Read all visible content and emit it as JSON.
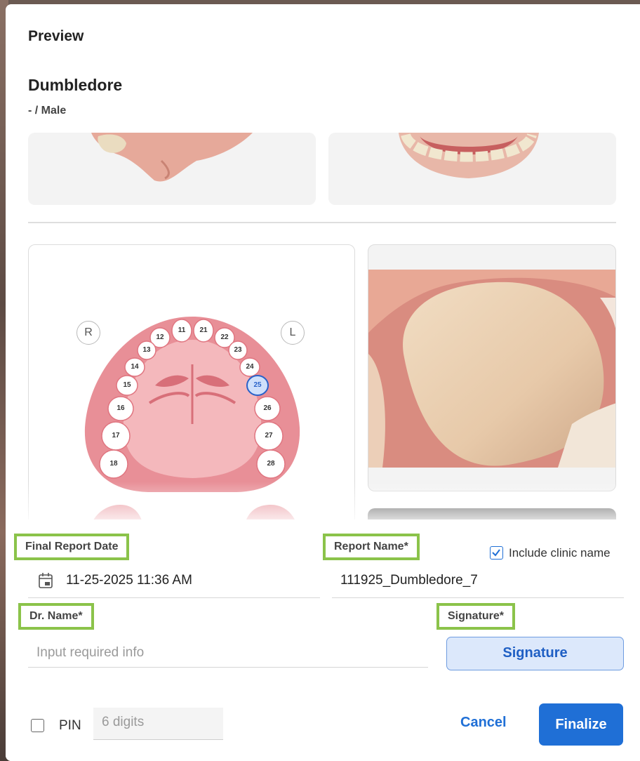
{
  "dialog": {
    "title": "Preview",
    "patient_name": "Dumbledore",
    "patient_meta": "- / Male"
  },
  "tooth_chart": {
    "right_label": "R",
    "left_label": "L",
    "teeth": [
      "11",
      "12",
      "13",
      "14",
      "15",
      "16",
      "17",
      "18",
      "21",
      "22",
      "23",
      "24",
      "25",
      "26",
      "27",
      "28"
    ],
    "selected_tooth": "25"
  },
  "form": {
    "final_report_date_label": "Final Report Date",
    "final_report_date_value": "11-25-2025 11:36 AM",
    "report_name_label": "Report Name*",
    "report_name_value": "111925_Dumbledore_7",
    "include_clinic_label": "Include clinic name",
    "include_clinic_checked": true,
    "dr_name_label": "Dr. Name*",
    "dr_name_placeholder": "Input required info",
    "signature_label": "Signature*",
    "signature_button": "Signature",
    "pin_label": "PIN",
    "pin_placeholder": "6 digits",
    "cancel_button": "Cancel",
    "finalize_button": "Finalize"
  },
  "colors": {
    "accent": "#1f6fd6",
    "highlight": "#8bc34a",
    "gum": "#e88f97"
  }
}
